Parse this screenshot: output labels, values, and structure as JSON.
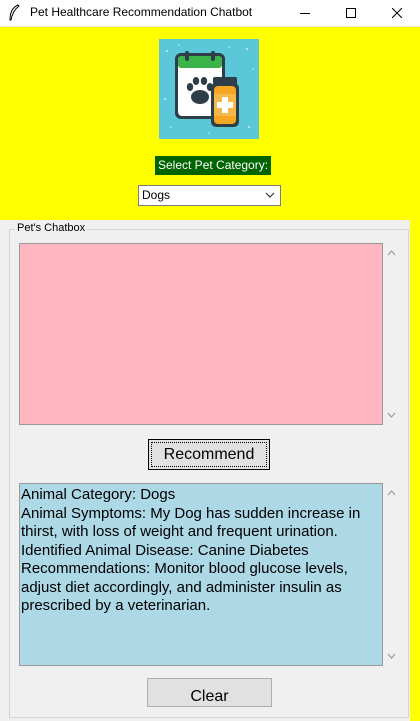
{
  "window": {
    "title": "Pet Healthcare Recommendation Chatbot"
  },
  "category": {
    "label": "Select Pet Category:",
    "selected": "Dogs"
  },
  "chatbox": {
    "label": "Pet's Chatbox"
  },
  "recommend_label": "Recommend",
  "clear_label": "Clear",
  "output_lines": [
    "Animal Category: Dogs",
    "Animal Symptoms: My Dog has sudden increase in",
    "thirst, with loss of weight and frequent urination.",
    "Identified Animal Disease: Canine Diabetes",
    "Recommendations: Monitor blood glucose levels,",
    "adjust diet accordingly, and administer insulin as",
    "prescribed by a veterinarian."
  ],
  "colors": {
    "background": "#ffff00",
    "label_bg": "#006400",
    "input_bg": "#ffb6c1",
    "output_bg": "#add8e6"
  },
  "icons": {
    "app": "feather-icon",
    "logo": "pet-healthcare-logo",
    "dropdown": "chevron-down-icon"
  }
}
